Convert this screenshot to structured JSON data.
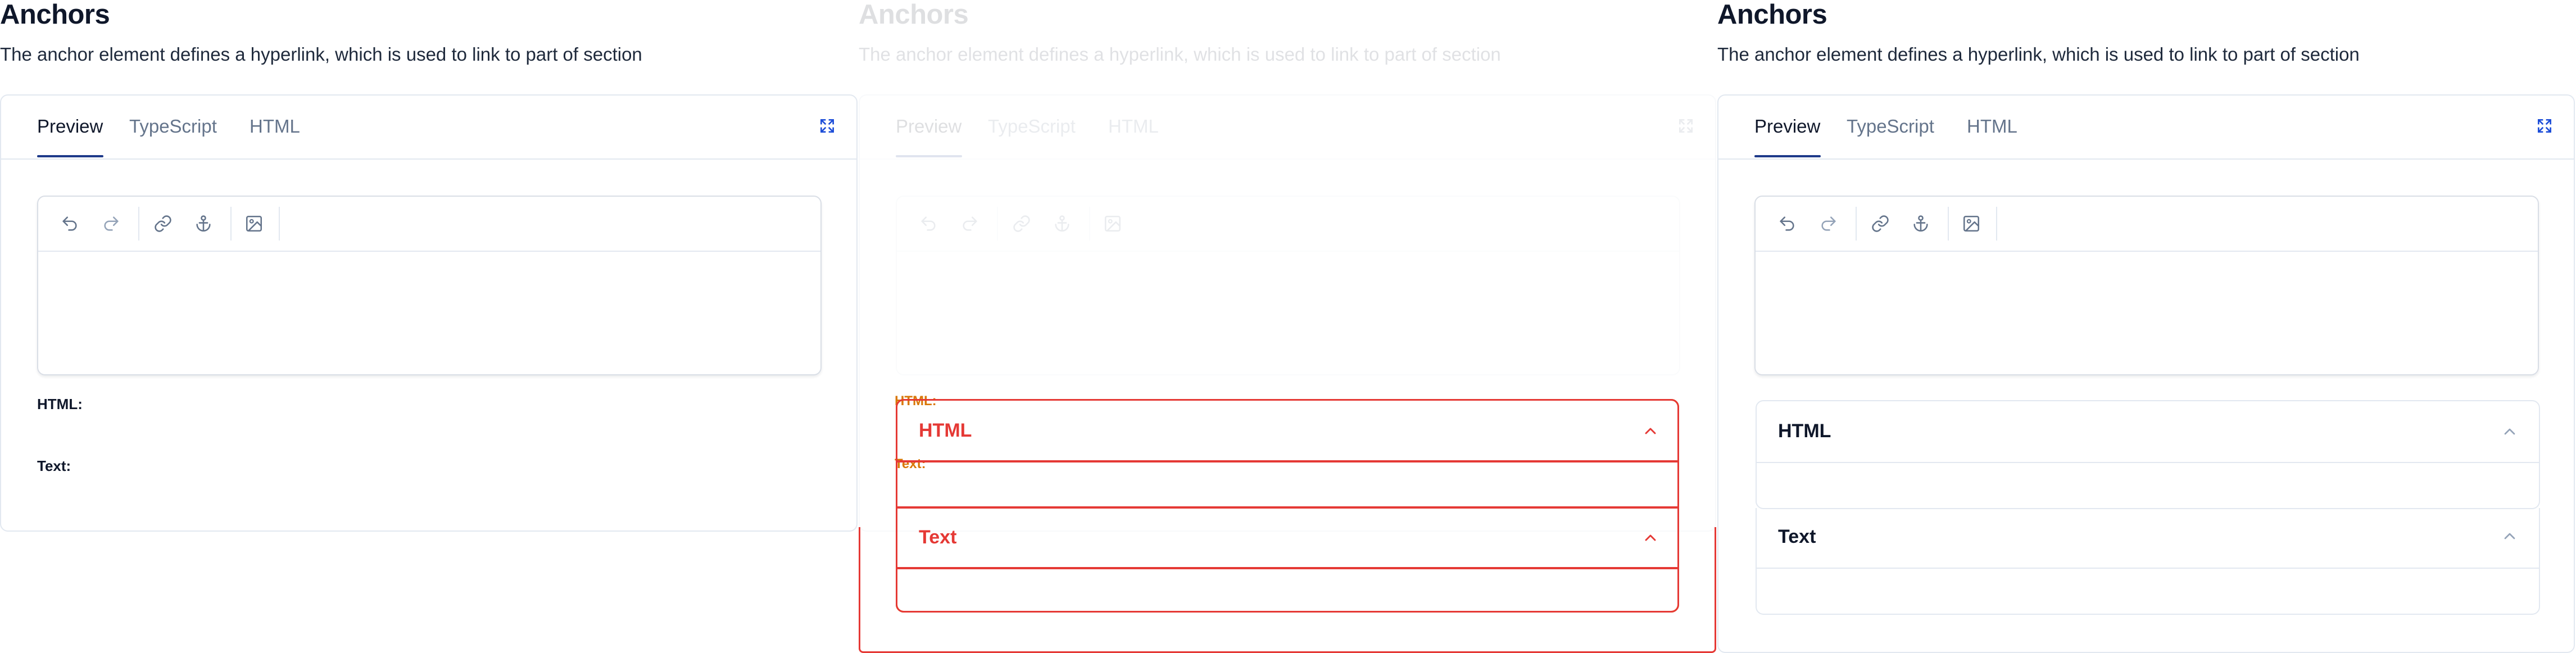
{
  "section": {
    "title": "Anchors",
    "description": "The anchor element defines a hyperlink, which is used to link to part of section"
  },
  "tabs": [
    {
      "label": "Preview",
      "active": true
    },
    {
      "label": "TypeScript",
      "active": false
    },
    {
      "label": "HTML",
      "active": false
    }
  ],
  "icons": {
    "expand": "expand-icon",
    "toolbar": [
      "undo-icon",
      "redo-icon",
      "link-icon",
      "anchor-icon",
      "image-icon"
    ],
    "accordion": "chevron-up-icon"
  },
  "output_labels": {
    "html": "HTML:",
    "text": "Text:"
  },
  "accordions": [
    {
      "title": "HTML",
      "expanded": true
    },
    {
      "title": "Text",
      "expanded": true
    }
  ],
  "colors": {
    "accent": "#1e3a8a",
    "border": "#e2e8f0",
    "overlay_red": "#e53935",
    "overlay_orange": "#f59e0b"
  }
}
